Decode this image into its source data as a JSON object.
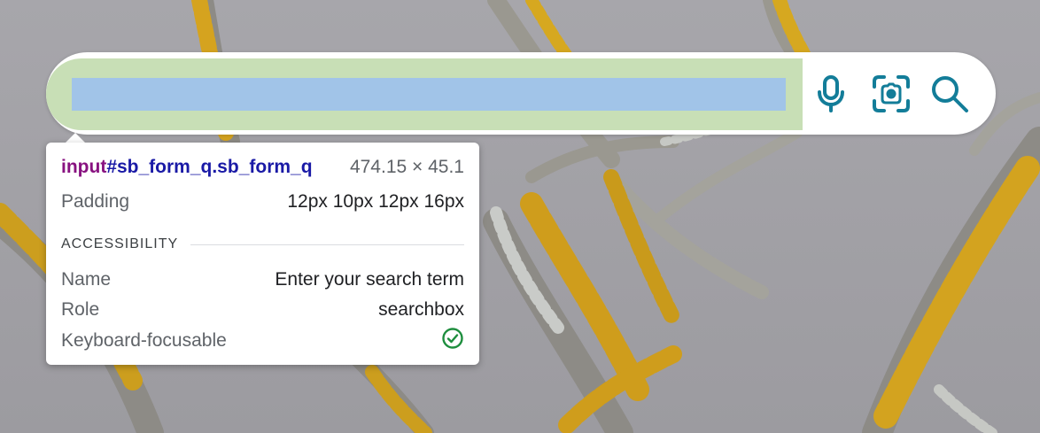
{
  "search": {
    "placeholder": "",
    "value": ""
  },
  "icons": {
    "voice": "microphone-icon",
    "visual_search": "camera-scan-icon",
    "search": "search-icon",
    "accent_color": "#137d99"
  },
  "inspector": {
    "tag": "input",
    "selector_rest": "#sb_form_q.sb_form_q",
    "size": "474.15 × 45.1",
    "padding_label": "Padding",
    "padding_value": "12px 10px 12px 16px",
    "accessibility_title": "ACCESSIBILITY",
    "name_label": "Name",
    "name_value": "Enter your search term",
    "role_label": "Role",
    "role_value": "searchbox",
    "focusable_label": "Keyboard-focusable",
    "focusable_icon": "check-circle-icon",
    "focusable_color": "#1e8e3e"
  },
  "colors": {
    "input_highlight": "#c8dfb6",
    "content_highlight": "#a1c4e8"
  }
}
